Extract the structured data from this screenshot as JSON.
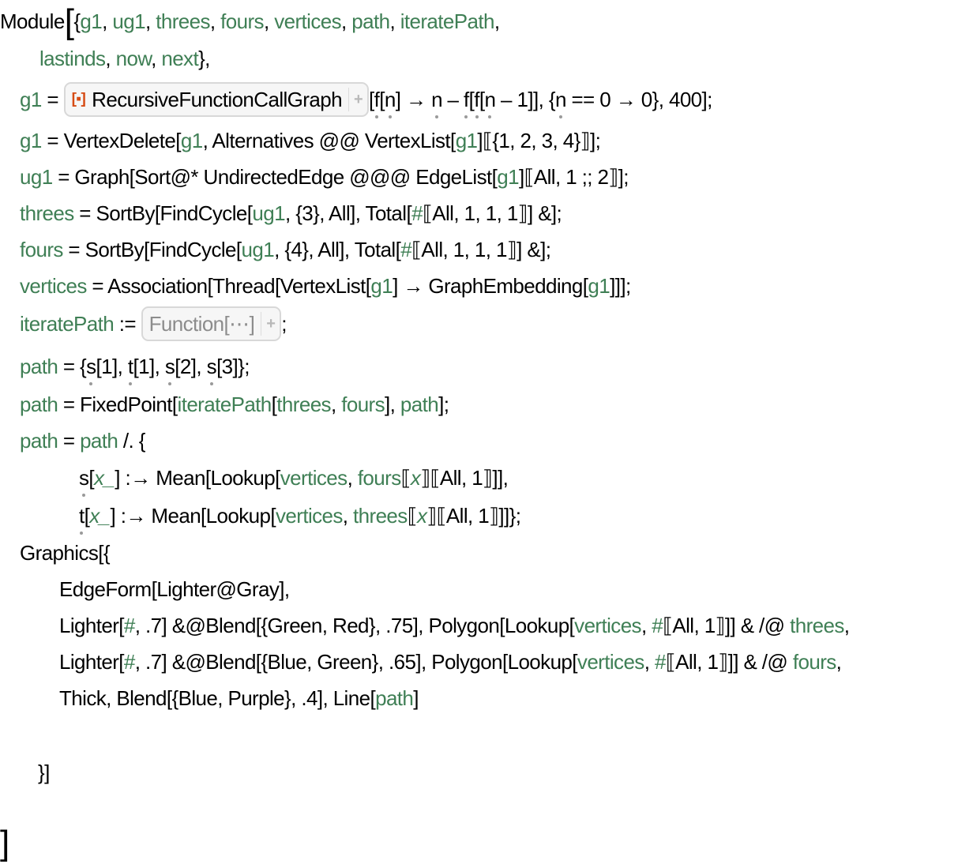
{
  "code": {
    "module_kw": "Module",
    "locals_line1": [
      "g1",
      "ug1",
      "threes",
      "fours",
      "vertices",
      "path",
      "iteratePath"
    ],
    "locals_line2": [
      "lastinds",
      "now",
      "next"
    ],
    "resource_function": {
      "icon": "resource-function-icon",
      "name": "RecursiveFunctionCallGraph",
      "icon_color": "#d64b14"
    },
    "function_box": {
      "label": "Function[⋯]"
    },
    "lines": [
      "g1 = RecursiveFunctionCallGraph[f[n] → n – f[f[n – 1]], {n == 0 → 0}, 400];",
      "g1 = VertexDelete[g1, Alternatives @@ VertexList[g1]〚{1, 2, 3, 4}〛];",
      "ug1 = Graph[Sort@* UndirectedEdge @@@ EdgeList[g1]〚All, 1 ;; 2〛];",
      "threes = SortBy[FindCycle[ug1, {3}, All], Total[#〚All, 1, 1, 1〛] &];",
      "fours = SortBy[FindCycle[ug1, {4}, All], Total[#〚All, 1, 1, 1〛] &];",
      "vertices = Association[Thread[VertexList[g1] → GraphEmbedding[g1]]];",
      "iteratePath := Function[⋯];",
      "path = {s[1], t[1], s[2], s[3]};",
      "path = FixedPoint[iteratePath[threes, fours], path];",
      "path = path /. {",
      "s[x_] :→ Mean[Lookup[vertices, fours〚x〛〚All, 1〛]],",
      "t[x_] :→ Mean[Lookup[vertices, threes〚x〛〚All, 1〛]]};",
      "Graphics[{",
      "EdgeForm[Lighter@Gray],",
      "Lighter[#, .7] &@Blend[{Green, Red}, .75], Polygon[Lookup[vertices, #〚All, 1〛]] & /@ threes,",
      "Lighter[#, .7] &@Blend[{Blue, Green}, .65], Polygon[Lookup[vertices, #〚All, 1〛]] & /@ fours,",
      "Thick, Blend[{Blue, Purple}, .4], Line[path]",
      "}]",
      "]"
    ]
  },
  "colors": {
    "variable": "#3f7f55",
    "text": "#000000",
    "box_border": "#d8d8d8",
    "box_bg": "#f6f6f6"
  }
}
